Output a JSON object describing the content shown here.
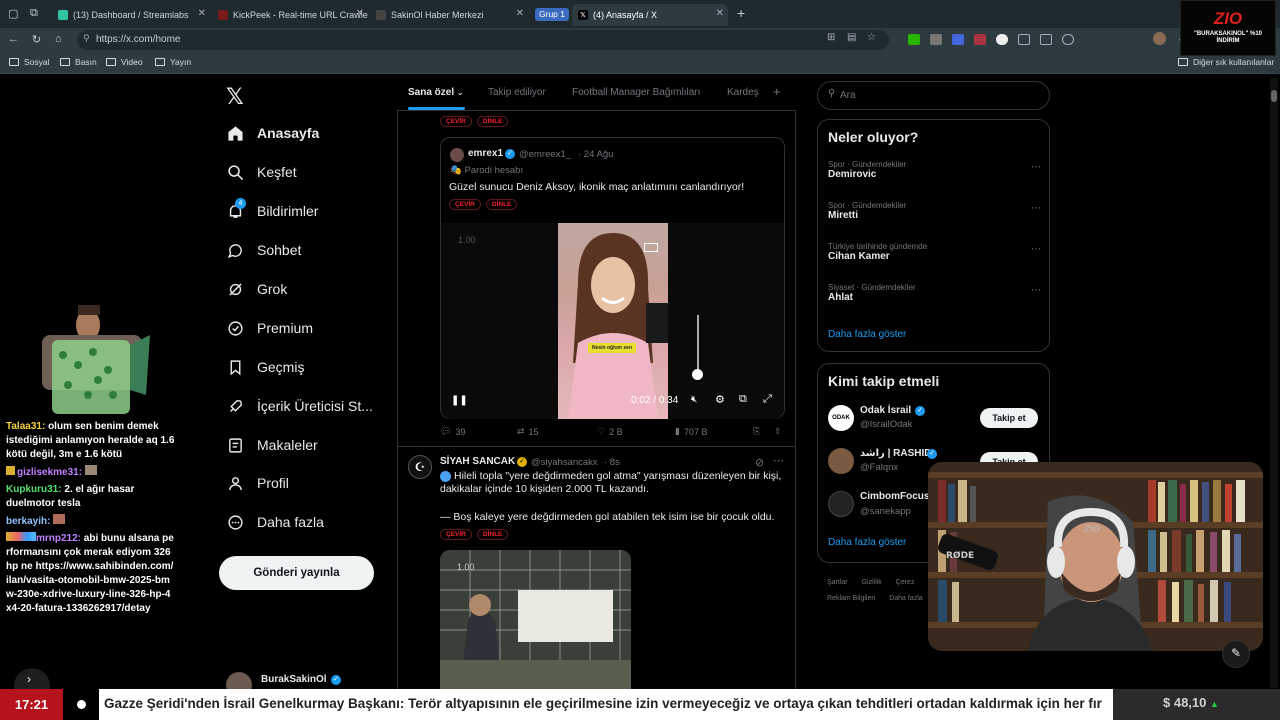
{
  "browser": {
    "tabs": [
      {
        "label": "(13) Dashboard / Streamlabs",
        "fav_color": "#31c3a2"
      },
      {
        "label": "KickPeek - Real-time URL Crawler",
        "fav_color": "#7a1a1a"
      },
      {
        "label": "SakinOl Haber Merkezi",
        "fav_color": "#444"
      },
      {
        "label": "(4) Anasayfa / X",
        "fav_color": "#000"
      }
    ],
    "tab_group": "Grup 1",
    "url": "https://x.com/home",
    "bookmarks": [
      "Sosyal",
      "Basın",
      "Video",
      "Yayın"
    ],
    "other_bookmarks": "Diğer sık kullanılanlar"
  },
  "sponsor": {
    "logo": "ZIO",
    "text": "\"BURAKSAKINOL\" %10 İNDİRİM"
  },
  "chat": [
    {
      "user": "Talaa31:",
      "msg": "olum sen benim demek istediğimi anlamıyon heralde aq 1.6 kötü değil, 3m e 1.6 kötü",
      "color": "#f7d23e"
    },
    {
      "user": "gizlisekme31:",
      "msg": "",
      "color": "#c080ff"
    },
    {
      "user": "Kupkuru31:",
      "msg": "2. el ağır hasar duelmotor tesla",
      "color": "#55e06a"
    },
    {
      "user": "berkayih:",
      "msg": "",
      "color": "#8ec3ff"
    },
    {
      "user": "mrnp212:",
      "msg": "abi bunu alsana performansını çok merak ediyom 326hp ne https://www.sahibinden.com/ilan/vasita-otomobil-bmw-2025-bmw-230e-xdrive-luxury-line-326-hp-4x4-20-fatura-1336262917/detay",
      "color": "#c080ff"
    }
  ],
  "nav": {
    "items": [
      {
        "label": "Anasayfa",
        "icon": "home-icon"
      },
      {
        "label": "Keşfet",
        "icon": "search-icon"
      },
      {
        "label": "Bildirimler",
        "icon": "bell-icon",
        "badge": "4"
      },
      {
        "label": "Sohbet",
        "icon": "chat-icon"
      },
      {
        "label": "Grok",
        "icon": "grok-icon"
      },
      {
        "label": "Premium",
        "icon": "premium-icon"
      },
      {
        "label": "Geçmiş",
        "icon": "bookmark-icon"
      },
      {
        "label": "İçerik Üreticisi St...",
        "icon": "rocket-icon"
      },
      {
        "label": "Makaleler",
        "icon": "article-icon"
      },
      {
        "label": "Profil",
        "icon": "profile-icon"
      },
      {
        "label": "Daha fazla",
        "icon": "more-icon"
      }
    ],
    "post_button": "Gönderi yayınla",
    "account_name": "BurakSakinOl"
  },
  "feed": {
    "tabs": [
      "Sana özel",
      "Takip ediliyor",
      "Football Manager Bağımlıları",
      "Kardeş"
    ],
    "pill_translate": "ÇEVİR",
    "pill_listen": "DİNLE",
    "quote": {
      "name": "emrex1",
      "handle": "@emreex1_",
      "date": "· 24 Ağu",
      "parody": "Parodi hesabı",
      "text": "Güzel sunucu Deniz Aksoy, ikonik maç anlatımını canlandırıyor!",
      "video_speed": "1.00",
      "video_time": "0:02 / 0:34",
      "caption": "Nesin oğlum sen"
    },
    "quote_actions": {
      "replies": "39",
      "reposts": "15",
      "likes": "2 B",
      "views": "707 B"
    },
    "post2": {
      "name": "SİYAH SANCAK",
      "handle": "@siyahsancakx",
      "time": "· 8s",
      "text1": "Hileli topla \"yere değdirmeden gol atma\" yarışması düzenleyen bir kişi, dakikalar içinde 10 kişiden 2.000 TL kazandı.",
      "text2": "— Boş kaleye yere değdirmeden gol atabilen tek isim ise bir çocuk oldu.",
      "video_speed": "1.00"
    }
  },
  "right": {
    "search_placeholder": "Ara",
    "trends_title": "Neler oluyor?",
    "trends": [
      {
        "cat": "Spor · Gündemdekiler",
        "name": "Demirovic"
      },
      {
        "cat": "Spor · Gündemdekiler",
        "name": "Miretti"
      },
      {
        "cat": "Türkiye tarihinde gündemde",
        "name": "Cihan Kamer"
      },
      {
        "cat": "Siyaset · Gündemdekiler",
        "name": "Ahlat"
      }
    ],
    "show_more": "Daha fazla göster",
    "follow_title": "Kimi takip etmeli",
    "follow": [
      {
        "name": "Odak İsrail",
        "handle": "@IsrailOdak"
      },
      {
        "name": "راشد | RASHID",
        "handle": "@Falqnx"
      },
      {
        "name": "CimbomFocus",
        "handle": "@sanekapp"
      }
    ],
    "follow_label": "Takip et",
    "follow_more": "Daha fazla göster",
    "footer": [
      "Şartlar",
      "Gizlilik",
      "Çerez",
      "Reklam Bilgileri",
      "Daha fazla"
    ]
  },
  "ticker": {
    "time": "17:21",
    "news": "Gazze Şeridi'nden İsrail Genelkurmay Başkanı: Terör altyapısının ele geçirilmesine izin vermeyeceğiz ve ortaya çıkan tehditleri ortadan kaldırmak için her fır",
    "price": "$ 48,10"
  }
}
